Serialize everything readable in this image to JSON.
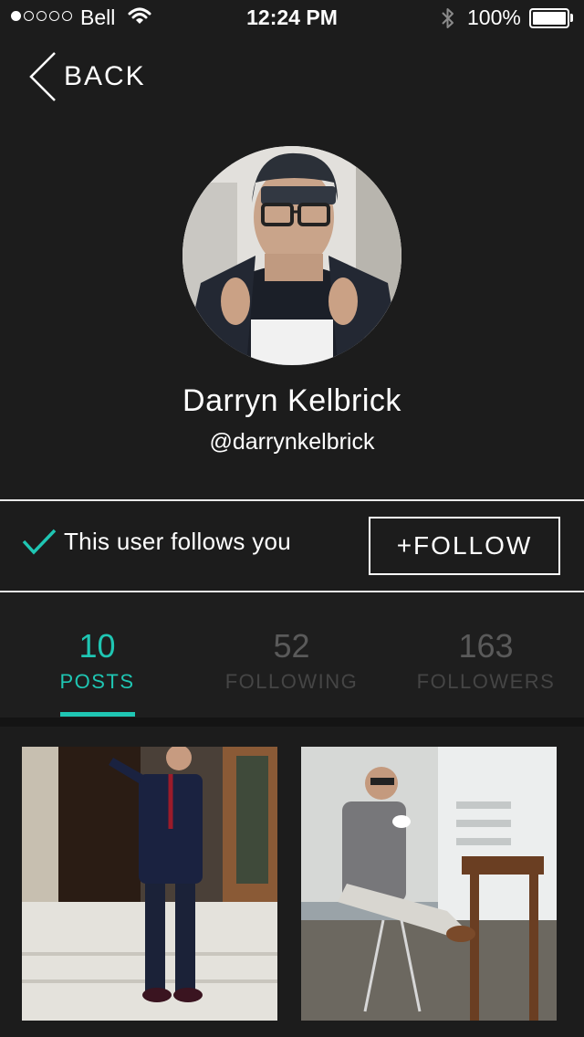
{
  "status_bar": {
    "carrier": "Bell",
    "time": "12:24 PM",
    "battery": "100%",
    "signal_bars_filled": 1,
    "signal_bars_total": 5
  },
  "nav": {
    "back_label": "BACK"
  },
  "profile": {
    "name": "Darryn Kelbrick",
    "handle": "@darrynkelbrick"
  },
  "relationship": {
    "follows_you_text": "This user follows you",
    "follow_button_label": "+FOLLOW"
  },
  "stats": [
    {
      "value": "10",
      "label": "POSTS",
      "active": true
    },
    {
      "value": "52",
      "label": "FOLLOWING",
      "active": false
    },
    {
      "value": "163",
      "label": "FOLLOWERS",
      "active": false
    }
  ],
  "posts": [
    {
      "icon": "photo-man-in-navy-military-jacket"
    },
    {
      "icon": "photo-man-in-grey-blazer-at-cafe"
    }
  ],
  "colors": {
    "background": "#1c1c1c",
    "accent": "#1fc6b3",
    "text": "#ffffff",
    "inactive_text": "#5a5a5a"
  }
}
